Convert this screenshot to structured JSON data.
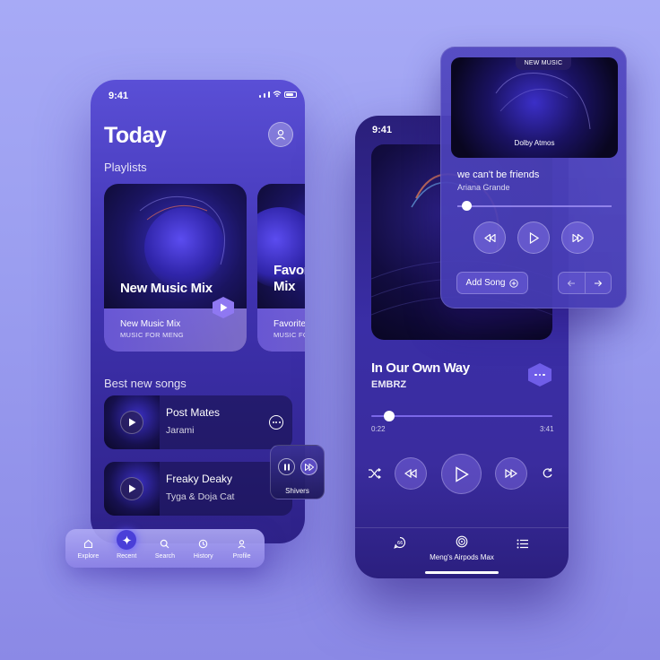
{
  "left_phone": {
    "status_time": "9:41",
    "title": "Today",
    "playlists_label": "Playlists",
    "playlists": [
      {
        "big_name": "New Music Mix",
        "name": "New Music Mix",
        "subtitle": "MUSIC FOR MENG"
      },
      {
        "big_name": "Favor Mix",
        "name": "Favorite",
        "subtitle": "MUSIC FOR"
      }
    ],
    "best_new_songs_label": "Best new songs",
    "songs": [
      {
        "title": "Post Mates",
        "artist": "Jarami"
      },
      {
        "title": "Freaky Deaky",
        "artist": "Tyga & Doja Cat"
      }
    ]
  },
  "mini_player": {
    "label": "Shivers"
  },
  "tabbar": {
    "active_index": 1,
    "tabs": [
      {
        "label": "Explore",
        "icon": "home-icon"
      },
      {
        "label": "Recent",
        "icon": "sparkle-icon"
      },
      {
        "label": "Search",
        "icon": "search-icon"
      },
      {
        "label": "History",
        "icon": "history-icon"
      },
      {
        "label": "Profile",
        "icon": "profile-icon"
      }
    ]
  },
  "right_phone": {
    "status_time": "9:41",
    "track_title": "In Our Own Way",
    "track_artist": "EMBRZ",
    "elapsed": "0:22",
    "duration": "3:41",
    "progress": 0.1,
    "output_device": "Meng's Airpods Max"
  },
  "widget": {
    "tag": "NEW MUSIC",
    "badge": "Dolby Atmos",
    "title": "we can't be friends",
    "artist": "Ariana Grande",
    "progress": 0.06,
    "add_song_label": "Add Song"
  },
  "colors": {
    "accent": "#6f5de8",
    "background": "#a0a3f3"
  }
}
